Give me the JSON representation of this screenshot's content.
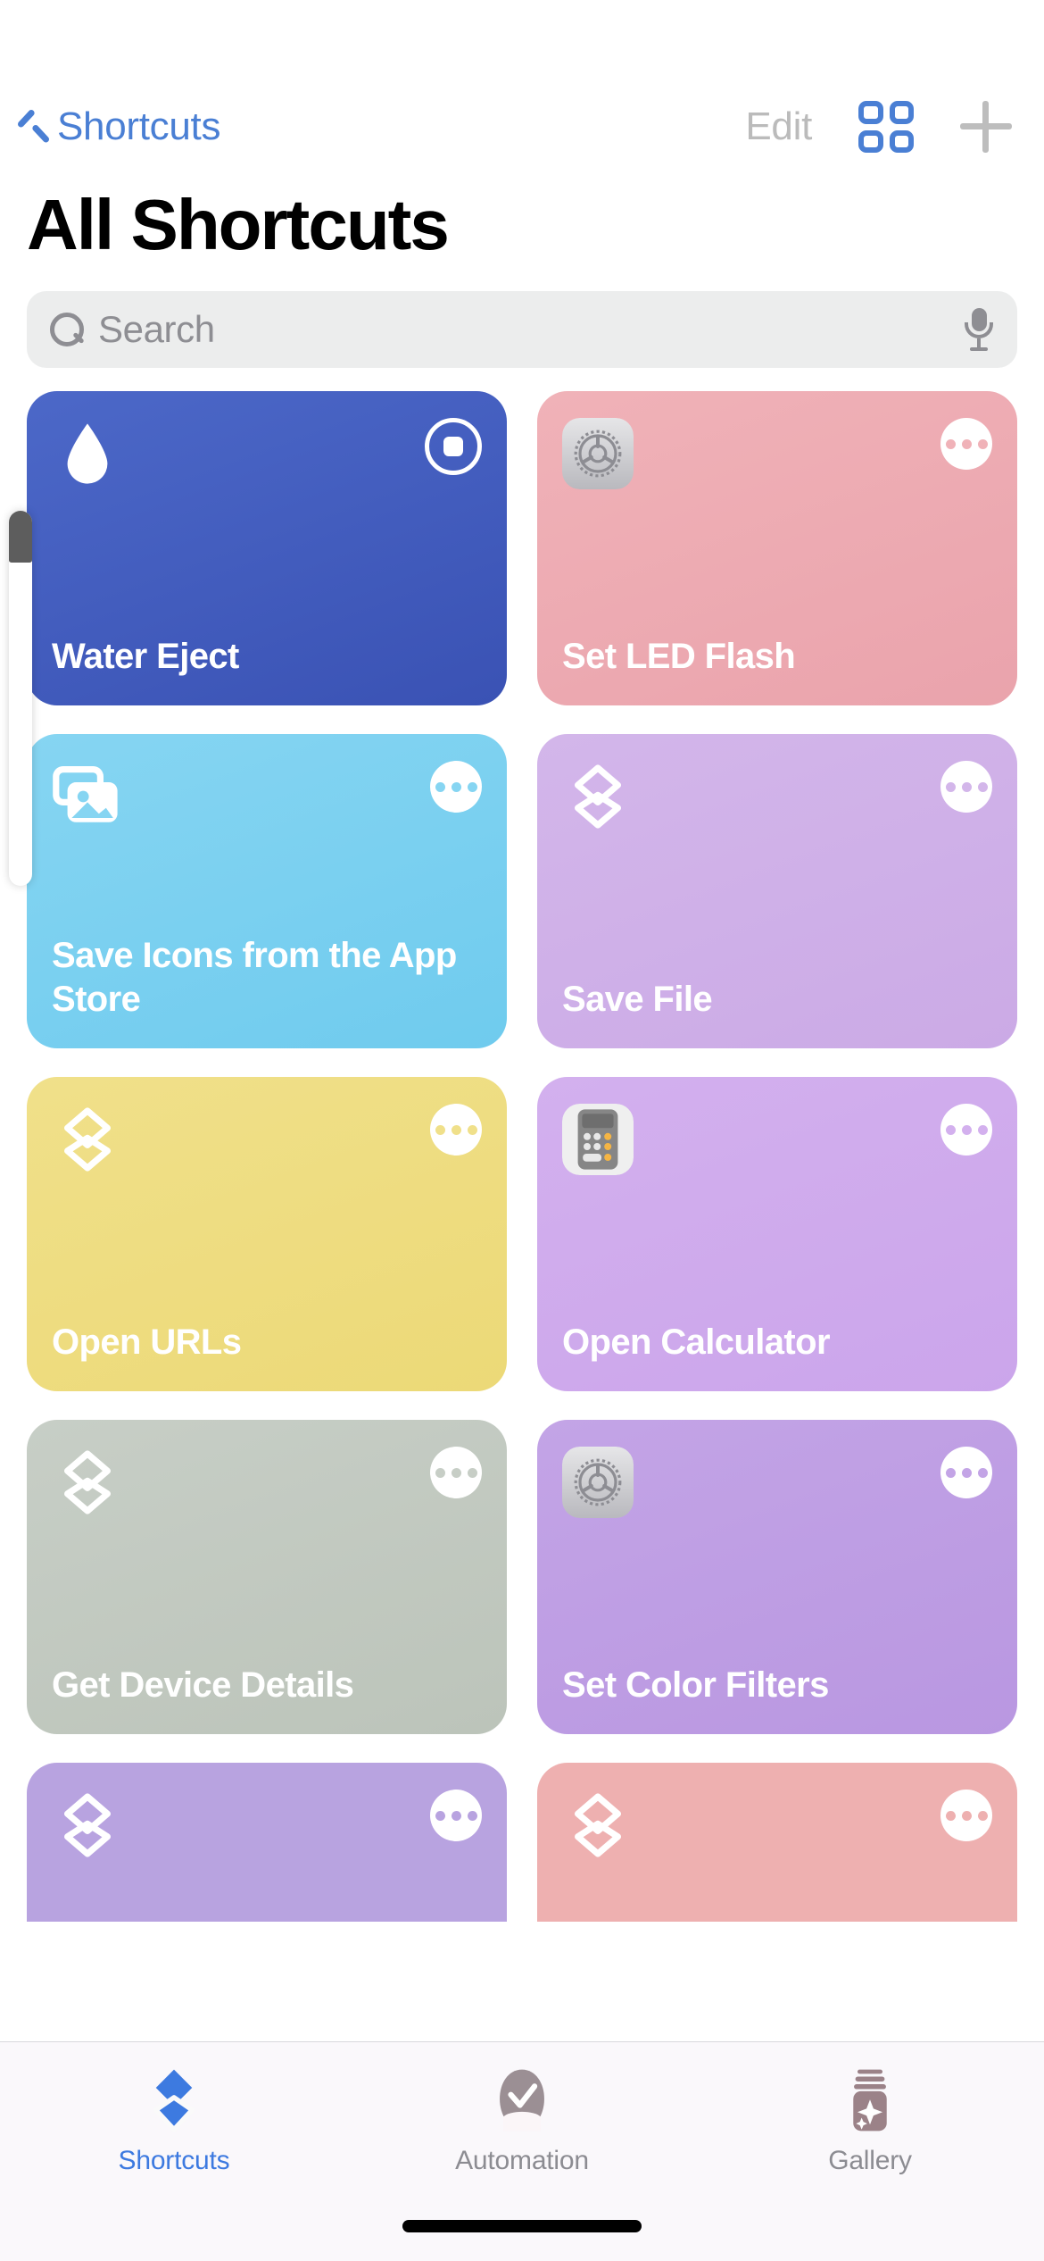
{
  "navbar": {
    "back_label": "Shortcuts",
    "back_icon": "chevron-left-icon",
    "edit_label": "Edit",
    "grid_icon": "grid-view-icon",
    "add_icon": "plus-icon"
  },
  "header": {
    "title": "All Shortcuts"
  },
  "search": {
    "placeholder": "Search",
    "value": "",
    "search_icon": "search-icon",
    "mic_icon": "microphone-icon"
  },
  "shortcuts": [
    {
      "title": "Water Eject",
      "color": "#4c68c8",
      "color_dark": "#3a52b4",
      "glyph": "water-drop-icon",
      "action_icon": "stop-button",
      "running": true
    },
    {
      "title": "Set LED Flash",
      "color": "#f0b2b8",
      "color_dark": "#eaa3ac",
      "glyph": "settings-app-icon",
      "action_icon": "more-button",
      "running": false
    },
    {
      "title": "Save Icons from the App Store",
      "color": "#86d5f2",
      "color_dark": "#6fcbee",
      "glyph": "photos-stack-icon",
      "action_icon": "more-button",
      "running": false
    },
    {
      "title": "Save File",
      "color": "#d3b6ea",
      "color_dark": "#cbaae6",
      "glyph": "shortcuts-layers-icon",
      "action_icon": "more-button",
      "running": false
    },
    {
      "title": "Open URLs",
      "color": "#f0e08a",
      "color_dark": "#ecd977",
      "glyph": "shortcuts-layers-icon",
      "action_icon": "more-button",
      "running": false
    },
    {
      "title": "Open Calculator",
      "color": "#d3b0ee",
      "color_dark": "#cba5eb",
      "glyph": "calculator-app-icon",
      "action_icon": "more-button",
      "running": false
    },
    {
      "title": "Get Device Details",
      "color": "#c7cec6",
      "color_dark": "#bcc4ba",
      "glyph": "shortcuts-layers-icon",
      "action_icon": "more-button",
      "running": false
    },
    {
      "title": "Set Color Filters",
      "color": "#c3a4e6",
      "color_dark": "#b997e1",
      "glyph": "settings-app-icon",
      "action_icon": "more-button",
      "running": false
    },
    {
      "title": "",
      "color": "#b8a3e0",
      "color_dark": "#b8a3e0",
      "glyph": "shortcuts-layers-icon",
      "action_icon": "more-button",
      "running": false,
      "clipped": true
    },
    {
      "title": "",
      "color": "#eeb0b0",
      "color_dark": "#eeb0b0",
      "glyph": "shortcuts-layers-icon",
      "action_icon": "more-button",
      "running": false,
      "clipped": true
    }
  ],
  "tabbar": {
    "items": [
      {
        "label": "Shortcuts",
        "icon": "shortcuts-layers-icon",
        "active": true
      },
      {
        "label": "Automation",
        "icon": "automation-check-icon",
        "active": false
      },
      {
        "label": "Gallery",
        "icon": "gallery-jar-icon",
        "active": false
      }
    ]
  },
  "overlay": {
    "stylus": "apple-pencil-stylus"
  }
}
